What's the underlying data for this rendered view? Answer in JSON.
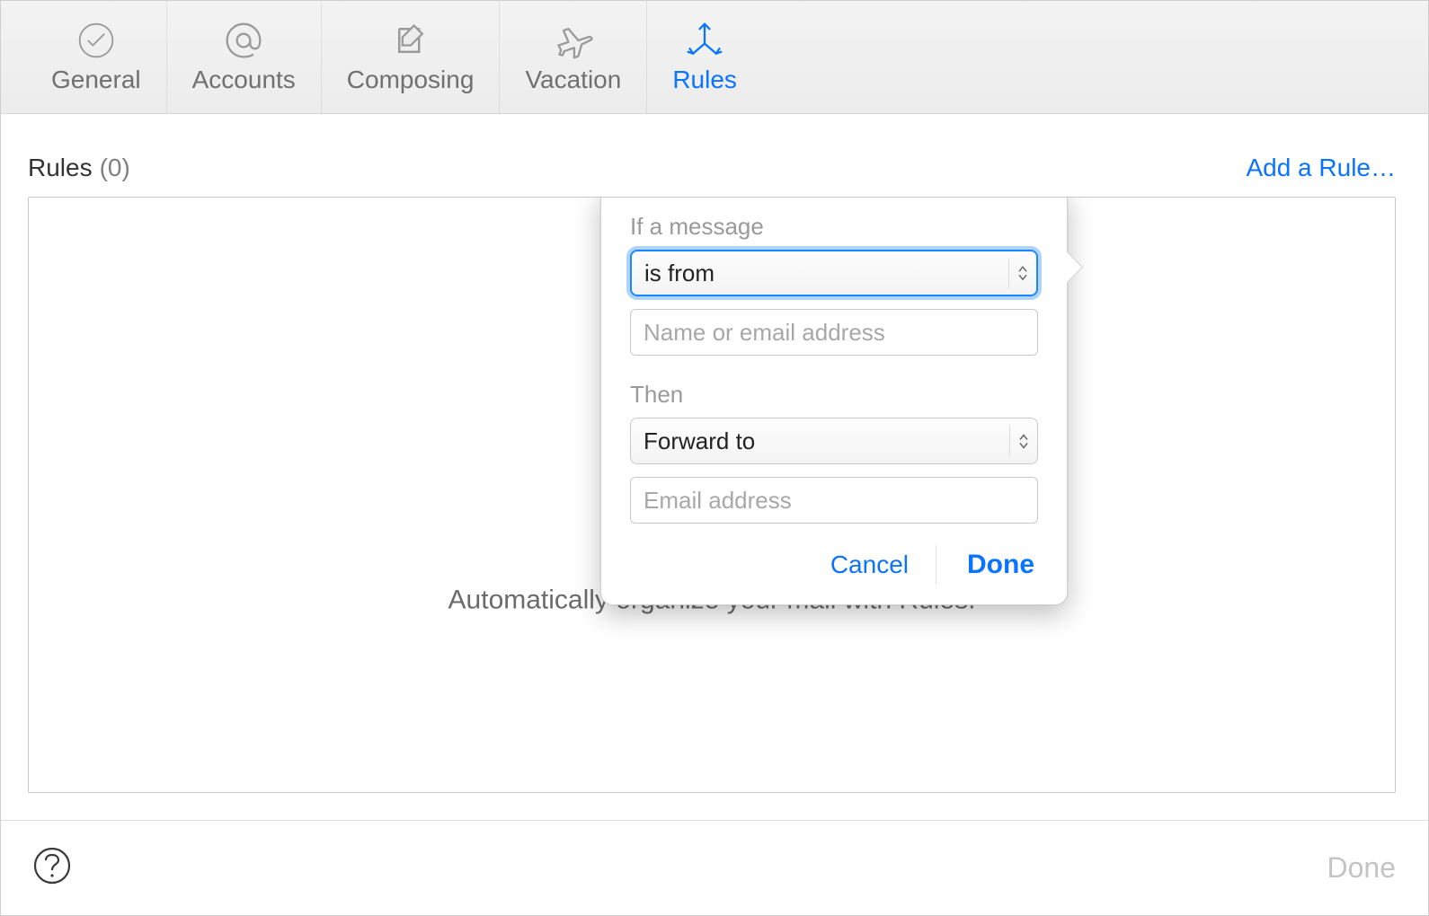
{
  "toolbar": {
    "items": [
      {
        "label": "General",
        "icon": "checkmark-icon",
        "active": false
      },
      {
        "label": "Accounts",
        "icon": "at-icon",
        "active": false
      },
      {
        "label": "Composing",
        "icon": "compose-icon",
        "active": false
      },
      {
        "label": "Vacation",
        "icon": "plane-icon",
        "active": false
      },
      {
        "label": "Rules",
        "icon": "rules-icon",
        "active": true
      }
    ]
  },
  "rules_panel": {
    "title": "Rules",
    "count_label": "(0)",
    "add_label": "Add a Rule…",
    "empty_caption": "Automatically organize your mail with Rules."
  },
  "popover": {
    "condition_label": "If a message",
    "condition_value": "is from",
    "condition_input_placeholder": "Name or email address",
    "action_label": "Then",
    "action_value": "Forward to",
    "action_input_placeholder": "Email address",
    "cancel_label": "Cancel",
    "done_label": "Done"
  },
  "footer": {
    "done_label": "Done"
  },
  "colors": {
    "accent": "#0a74ff"
  }
}
